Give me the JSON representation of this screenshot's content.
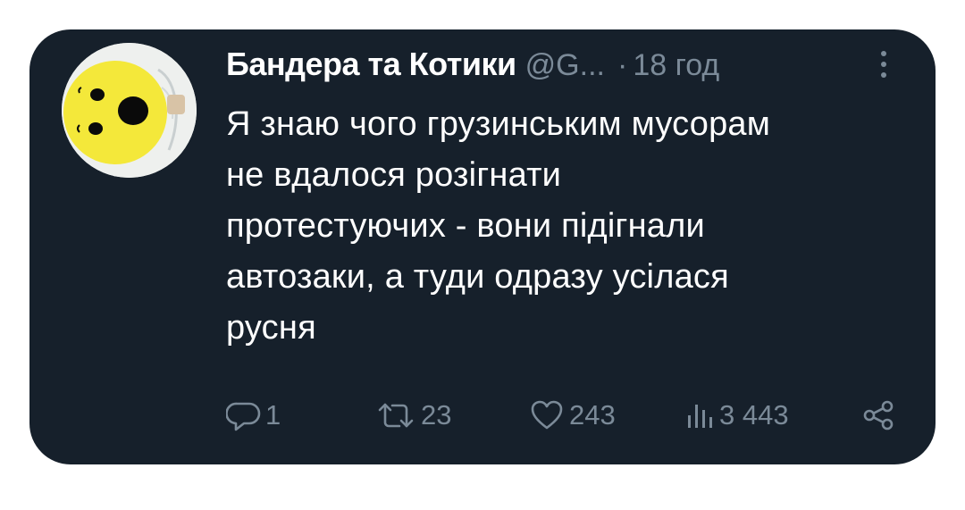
{
  "tweet": {
    "author_name": "Бандера та Котики",
    "handle": "@G...",
    "separator": "·",
    "time": "18 год",
    "lines": [
      "Я знаю чого грузинським мусорам",
      "не вдалося розігнати",
      "протестуючих - вони підігнали",
      "автозаки, а туди одразу усілася",
      "русня"
    ]
  },
  "stats": {
    "replies": "1",
    "retweets": "23",
    "likes": "243",
    "views": "3 443"
  },
  "icons": {
    "more": "more-options-icon",
    "reply": "reply-icon",
    "retweet": "retweet-icon",
    "like": "heart-icon",
    "views": "views-icon",
    "share": "share-icon"
  },
  "colors": {
    "card_background": "#16202b",
    "text_primary": "#ffffff",
    "text_secondary": "#7b8a98",
    "avatar_face": "#f4e83a"
  }
}
